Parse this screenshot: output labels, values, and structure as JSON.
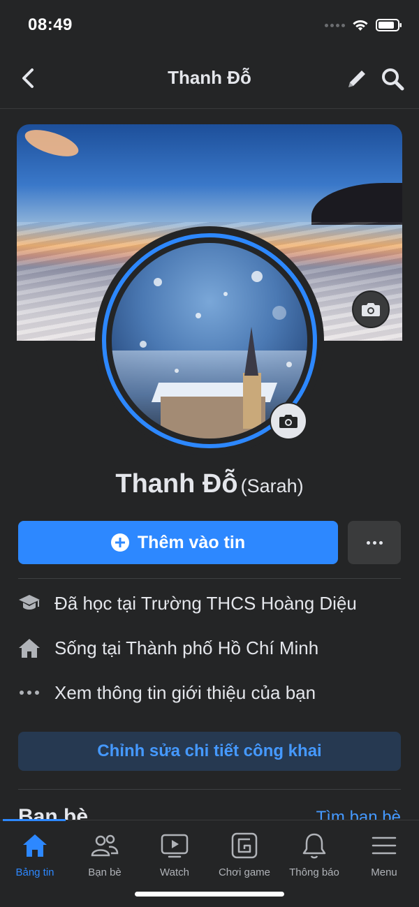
{
  "status_bar": {
    "time": "08:49"
  },
  "nav": {
    "title": "Thanh Đỗ"
  },
  "profile": {
    "name": "Thanh Đỗ",
    "nickname": "(Sarah)"
  },
  "actions": {
    "add_story_label": "Thêm vào tin"
  },
  "info": {
    "education": {
      "prefix": "Đã học tại",
      "place": "Trường THCS Hoàng Diệu"
    },
    "lives": {
      "prefix": "Sống tại",
      "place": "Thành phố Hồ Chí Minh"
    },
    "about_link": "Xem thông tin giới thiệu của bạn"
  },
  "edit_public_label": "Chỉnh sửa chi tiết công khai",
  "friends": {
    "heading": "Bạn bè",
    "find_link": "Tìm bạn bè"
  },
  "tabs": [
    {
      "label": "Bảng tin",
      "icon": "home-icon",
      "active": true
    },
    {
      "label": "Bạn bè",
      "icon": "friends-icon",
      "active": false
    },
    {
      "label": "Watch",
      "icon": "watch-icon",
      "active": false
    },
    {
      "label": "Chơi game",
      "icon": "gaming-icon",
      "active": false
    },
    {
      "label": "Thông báo",
      "icon": "bell-icon",
      "active": false
    },
    {
      "label": "Menu",
      "icon": "menu-icon",
      "active": false
    }
  ],
  "colors": {
    "accent": "#2d88ff",
    "background": "#242526",
    "link": "#4599ff",
    "secondary_button": "#3a3b3c"
  }
}
